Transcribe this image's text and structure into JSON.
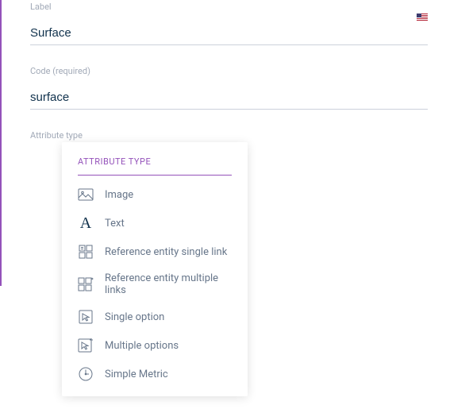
{
  "fields": {
    "label": {
      "caption": "Label",
      "value": "Surface"
    },
    "code": {
      "caption": "Code (required)",
      "value": "surface"
    },
    "attribute_type": {
      "caption": "Attribute type"
    }
  },
  "dropdown": {
    "header": "ATTRIBUTE TYPE",
    "options": {
      "image": "Image",
      "text": "Text",
      "ref_single": "Reference entity single link",
      "ref_multiple": "Reference entity multiple links",
      "single_option": "Single option",
      "multiple_options": "Multiple options",
      "simple_metric": "Simple Metric"
    }
  }
}
